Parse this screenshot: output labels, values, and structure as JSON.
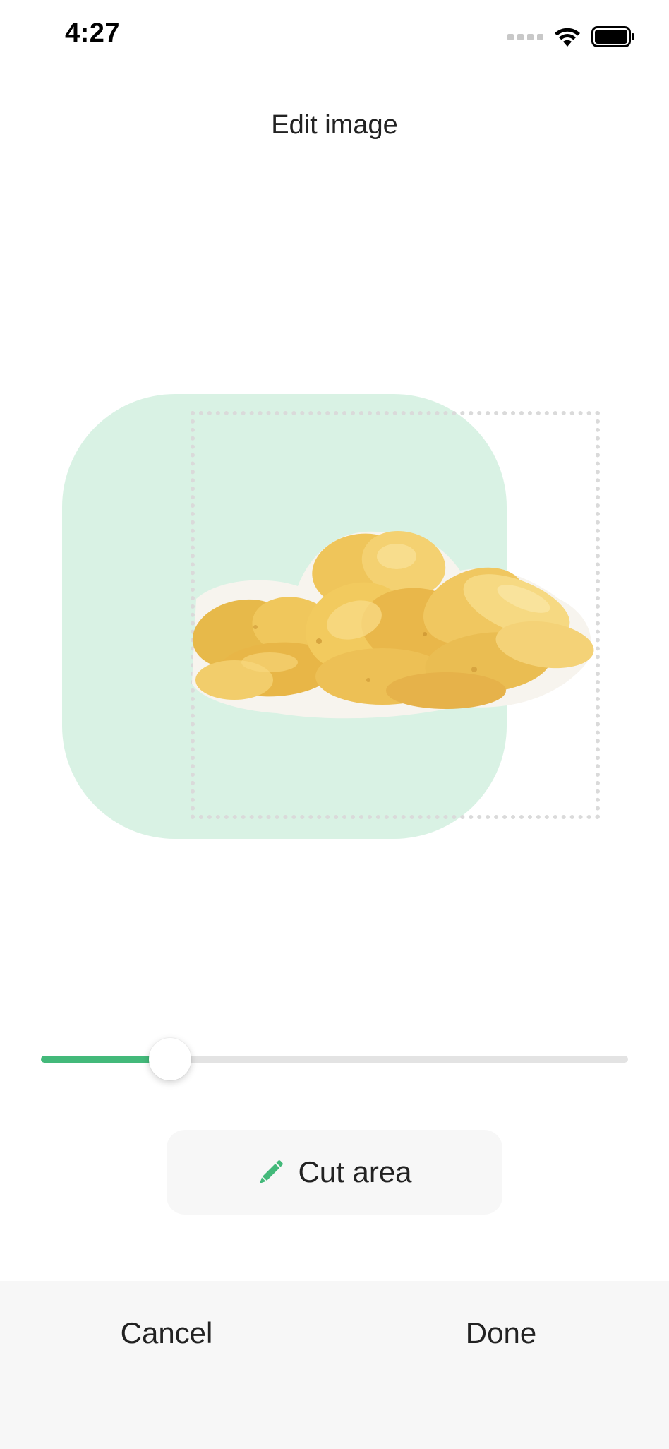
{
  "status_bar": {
    "time": "4:27",
    "icons": [
      "signal-icon",
      "wifi-icon",
      "battery-icon"
    ]
  },
  "header": {
    "title": "Edit image"
  },
  "editor": {
    "image_subject": "potato chips",
    "background_color": "#d9f2e4"
  },
  "slider": {
    "value": 0.22,
    "accent_color": "#43b97a"
  },
  "cut_area_button": {
    "label": "Cut area",
    "icon": "pencil-icon",
    "icon_color": "#43b97a"
  },
  "footer": {
    "cancel_label": "Cancel",
    "done_label": "Done"
  }
}
